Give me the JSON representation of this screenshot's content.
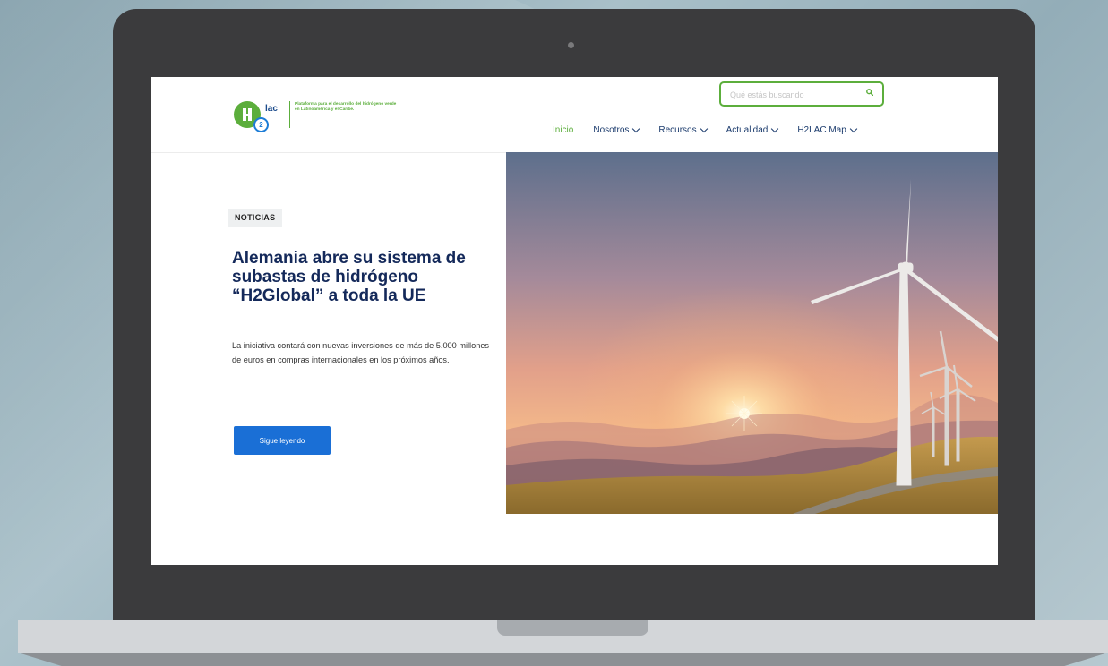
{
  "logo": {
    "mark": "H",
    "sub": "2",
    "lac": "lac",
    "tagline": "Plataforma para el desarrollo del hidrógeno verde en Latinoamérica y el Caribe."
  },
  "search": {
    "placeholder": "Qué estás buscando"
  },
  "nav": {
    "items": [
      {
        "label": "Inicio",
        "active": true
      },
      {
        "label": "Nosotros"
      },
      {
        "label": "Recursos"
      },
      {
        "label": "Actualidad"
      },
      {
        "label": "H2LAC Map"
      }
    ]
  },
  "hero": {
    "badge": "NOTICIAS",
    "title": "Alemania abre su sistema de subastas de hidrógeno “H2Global” a toda la UE",
    "lede": "La iniciativa contará con nuevas inversiones de más de 5.000 millones de euros en compras internacionales en los próximos años.",
    "cta": "Sigue leyendo",
    "image": "wind-turbines-sunset"
  },
  "colors": {
    "brand_green": "#5cae3c",
    "brand_navy": "#14295a",
    "cta_blue": "#1a6fd6",
    "laptop_body": "#3b3b3d"
  }
}
